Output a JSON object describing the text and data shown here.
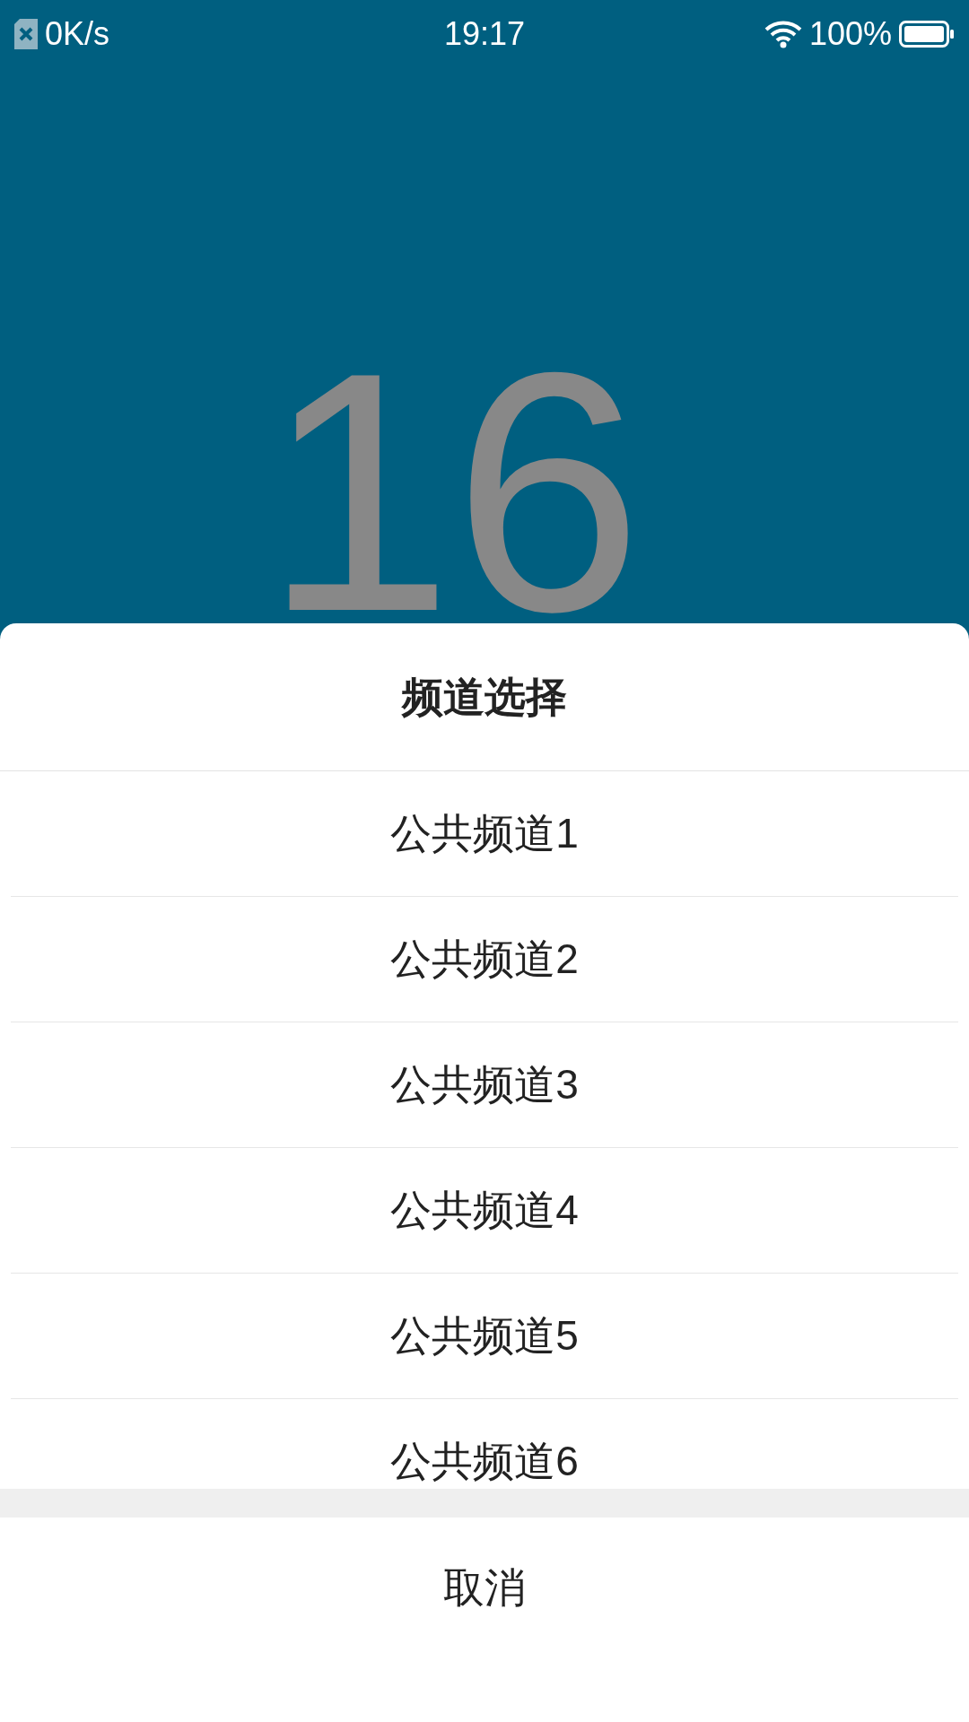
{
  "status_bar": {
    "speed": "0K/s",
    "time": "19:17",
    "battery": "100%"
  },
  "display": {
    "number": "16"
  },
  "sheet": {
    "title": "频道选择",
    "options": [
      {
        "label": "公共频道1"
      },
      {
        "label": "公共频道2"
      },
      {
        "label": "公共频道3"
      },
      {
        "label": "公共频道4"
      },
      {
        "label": "公共频道5"
      },
      {
        "label": "公共频道6"
      }
    ],
    "cancel": "取消"
  }
}
